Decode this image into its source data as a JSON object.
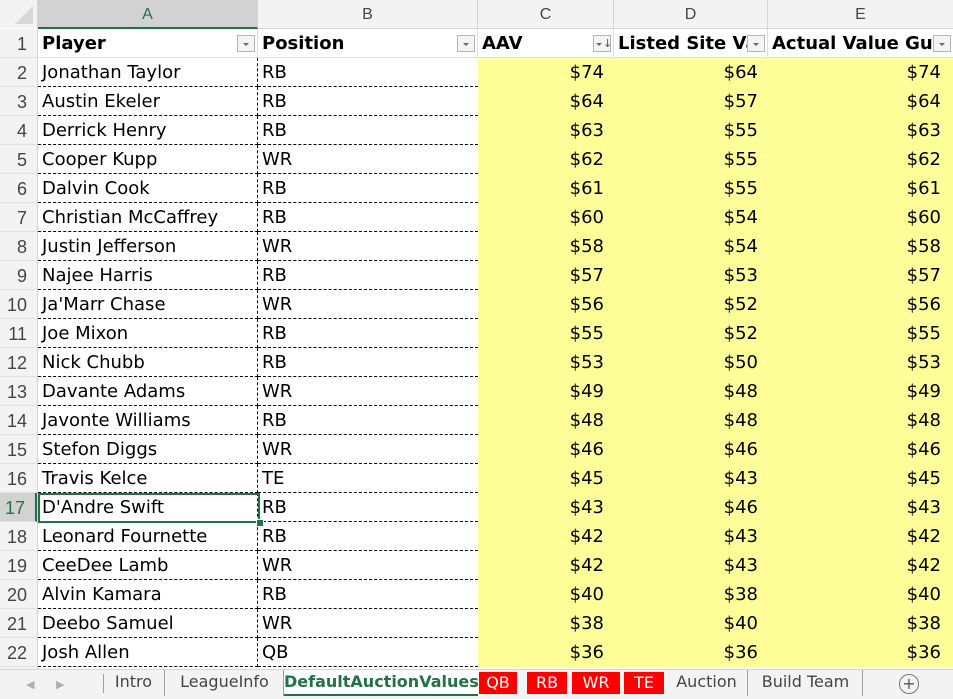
{
  "columns": [
    {
      "letter": "A",
      "header": "Player",
      "filter": "filter"
    },
    {
      "letter": "B",
      "header": "Position",
      "filter": "filter"
    },
    {
      "letter": "C",
      "header": "AAV",
      "filter": "sort-descending"
    },
    {
      "letter": "D",
      "header": "Listed Site Val",
      "filter": "filter"
    },
    {
      "letter": "E",
      "header": "Actual Value Gue",
      "filter": "filter"
    }
  ],
  "active_cell": "A17",
  "rows": [
    {
      "num": "2",
      "player": "Jonathan Taylor",
      "pos": "RB",
      "aav": "$74",
      "listed": "$64",
      "actual": "$74"
    },
    {
      "num": "3",
      "player": "Austin Ekeler",
      "pos": "RB",
      "aav": "$64",
      "listed": "$57",
      "actual": "$64"
    },
    {
      "num": "4",
      "player": "Derrick Henry",
      "pos": "RB",
      "aav": "$63",
      "listed": "$55",
      "actual": "$63"
    },
    {
      "num": "5",
      "player": "Cooper Kupp",
      "pos": "WR",
      "aav": "$62",
      "listed": "$55",
      "actual": "$62"
    },
    {
      "num": "6",
      "player": "Dalvin Cook",
      "pos": "RB",
      "aav": "$61",
      "listed": "$55",
      "actual": "$61"
    },
    {
      "num": "7",
      "player": "Christian McCaffrey",
      "pos": "RB",
      "aav": "$60",
      "listed": "$54",
      "actual": "$60"
    },
    {
      "num": "8",
      "player": "Justin Jefferson",
      "pos": "WR",
      "aav": "$58",
      "listed": "$54",
      "actual": "$58"
    },
    {
      "num": "9",
      "player": "Najee Harris",
      "pos": "RB",
      "aav": "$57",
      "listed": "$53",
      "actual": "$57"
    },
    {
      "num": "10",
      "player": "Ja'Marr Chase",
      "pos": "WR",
      "aav": "$56",
      "listed": "$52",
      "actual": "$56"
    },
    {
      "num": "11",
      "player": "Joe Mixon",
      "pos": "RB",
      "aav": "$55",
      "listed": "$52",
      "actual": "$55"
    },
    {
      "num": "12",
      "player": "Nick Chubb",
      "pos": "RB",
      "aav": "$53",
      "listed": "$50",
      "actual": "$53"
    },
    {
      "num": "13",
      "player": "Davante Adams",
      "pos": "WR",
      "aav": "$49",
      "listed": "$48",
      "actual": "$49"
    },
    {
      "num": "14",
      "player": "Javonte Williams",
      "pos": "RB",
      "aav": "$48",
      "listed": "$48",
      "actual": "$48"
    },
    {
      "num": "15",
      "player": "Stefon Diggs",
      "pos": "WR",
      "aav": "$46",
      "listed": "$46",
      "actual": "$46"
    },
    {
      "num": "16",
      "player": "Travis Kelce",
      "pos": "TE",
      "aav": "$45",
      "listed": "$43",
      "actual": "$45"
    },
    {
      "num": "17",
      "player": "D'Andre Swift",
      "pos": "RB",
      "aav": "$43",
      "listed": "$46",
      "actual": "$43"
    },
    {
      "num": "18",
      "player": "Leonard Fournette",
      "pos": "RB",
      "aav": "$42",
      "listed": "$43",
      "actual": "$42"
    },
    {
      "num": "19",
      "player": "CeeDee Lamb",
      "pos": "WR",
      "aav": "$42",
      "listed": "$43",
      "actual": "$42"
    },
    {
      "num": "20",
      "player": "Alvin Kamara",
      "pos": "RB",
      "aav": "$40",
      "listed": "$38",
      "actual": "$40"
    },
    {
      "num": "21",
      "player": "Deebo Samuel",
      "pos": "WR",
      "aav": "$38",
      "listed": "$40",
      "actual": "$38"
    },
    {
      "num": "22",
      "player": "Josh Allen",
      "pos": "QB",
      "aav": "$36",
      "listed": "$36",
      "actual": "$36"
    }
  ],
  "sheet_tabs": [
    {
      "label": "Intro",
      "style": "normal"
    },
    {
      "label": "LeagueInfo",
      "style": "normal"
    },
    {
      "label": "DefaultAuctionValues",
      "style": "active"
    },
    {
      "label": "QB",
      "style": "red"
    },
    {
      "label": "RB",
      "style": "red"
    },
    {
      "label": "WR",
      "style": "red"
    },
    {
      "label": "TE",
      "style": "red"
    },
    {
      "label": "Auction",
      "style": "normal"
    },
    {
      "label": "Build Team",
      "style": "normal"
    }
  ],
  "add_sheet_label": "+",
  "colors": {
    "accent": "#217346",
    "highlight": "#ffff99",
    "tab_red": "#ff0000"
  }
}
